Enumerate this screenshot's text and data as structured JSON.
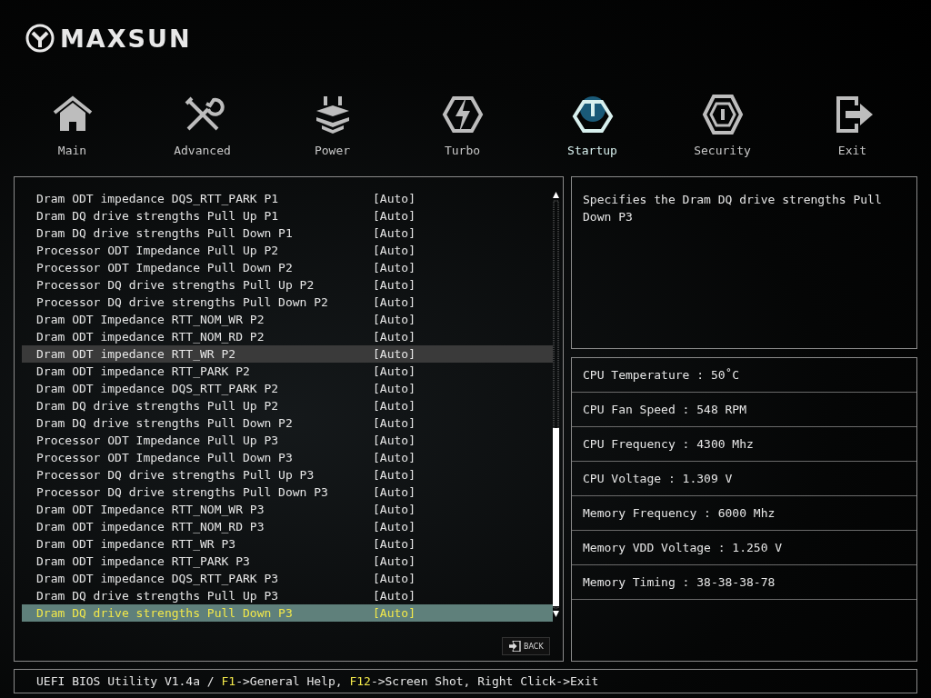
{
  "brand": {
    "name": "MAXSUN"
  },
  "tabs": [
    {
      "label": "Main",
      "selected": false
    },
    {
      "label": "Advanced",
      "selected": false
    },
    {
      "label": "Power",
      "selected": false
    },
    {
      "label": "Turbo",
      "selected": false
    },
    {
      "label": "Startup",
      "selected": true
    },
    {
      "label": "Security",
      "selected": false
    },
    {
      "label": "Exit",
      "selected": false
    }
  ],
  "settings": [
    {
      "name": "Dram ODT impedance DQS_RTT_PARK P1",
      "value": "[Auto]",
      "selected": false,
      "hovered": false
    },
    {
      "name": "Dram DQ drive strengths Pull Up P1",
      "value": "[Auto]",
      "selected": false,
      "hovered": false
    },
    {
      "name": "Dram DQ drive strengths Pull Down P1",
      "value": "[Auto]",
      "selected": false,
      "hovered": false
    },
    {
      "name": "Processor ODT Impedance Pull Up P2",
      "value": "[Auto]",
      "selected": false,
      "hovered": false
    },
    {
      "name": "Processor ODT Impedance Pull Down P2",
      "value": "[Auto]",
      "selected": false,
      "hovered": false
    },
    {
      "name": "Processor DQ drive strengths Pull Up P2",
      "value": "[Auto]",
      "selected": false,
      "hovered": false
    },
    {
      "name": "Processor DQ drive strengths Pull Down P2",
      "value": "[Auto]",
      "selected": false,
      "hovered": false
    },
    {
      "name": "Dram ODT Impedance RTT_NOM_WR P2",
      "value": "[Auto]",
      "selected": false,
      "hovered": false
    },
    {
      "name": "Dram ODT impedance RTT_NOM_RD P2",
      "value": "[Auto]",
      "selected": false,
      "hovered": false
    },
    {
      "name": "Dram ODT impedance RTT_WR P2",
      "value": "[Auto]",
      "selected": false,
      "hovered": true
    },
    {
      "name": "Dram ODT impedance RTT_PARK P2",
      "value": "[Auto]",
      "selected": false,
      "hovered": false
    },
    {
      "name": "Dram ODT impedance DQS_RTT_PARK P2",
      "value": "[Auto]",
      "selected": false,
      "hovered": false
    },
    {
      "name": "Dram DQ drive strengths Pull Up P2",
      "value": "[Auto]",
      "selected": false,
      "hovered": false
    },
    {
      "name": "Dram DQ drive strengths Pull Down P2",
      "value": "[Auto]",
      "selected": false,
      "hovered": false
    },
    {
      "name": "Processor ODT Impedance Pull Up P3",
      "value": "[Auto]",
      "selected": false,
      "hovered": false
    },
    {
      "name": "Processor ODT Impedance Pull Down P3",
      "value": "[Auto]",
      "selected": false,
      "hovered": false
    },
    {
      "name": "Processor DQ drive strengths Pull Up P3",
      "value": "[Auto]",
      "selected": false,
      "hovered": false
    },
    {
      "name": "Processor DQ drive strengths Pull Down P3",
      "value": "[Auto]",
      "selected": false,
      "hovered": false
    },
    {
      "name": "Dram ODT Impedance RTT_NOM_WR P3",
      "value": "[Auto]",
      "selected": false,
      "hovered": false
    },
    {
      "name": "Dram ODT impedance RTT_NOM_RD P3",
      "value": "[Auto]",
      "selected": false,
      "hovered": false
    },
    {
      "name": "Dram ODT impedance RTT_WR P3",
      "value": "[Auto]",
      "selected": false,
      "hovered": false
    },
    {
      "name": "Dram ODT impedance RTT_PARK P3",
      "value": "[Auto]",
      "selected": false,
      "hovered": false
    },
    {
      "name": "Dram ODT impedance DQS_RTT_PARK P3",
      "value": "[Auto]",
      "selected": false,
      "hovered": false
    },
    {
      "name": "Dram DQ drive strengths Pull Up P3",
      "value": "[Auto]",
      "selected": false,
      "hovered": false
    },
    {
      "name": "Dram DQ drive strengths Pull Down P3",
      "value": "[Auto]",
      "selected": true,
      "hovered": false
    }
  ],
  "back_button": {
    "label": "BACK"
  },
  "help": {
    "text": "Specifies the Dram DQ drive strengths Pull Down P3"
  },
  "monitor": [
    "CPU Temperature : 50˚C",
    "CPU Fan Speed : 548 RPM",
    "CPU Frequency : 4300 Mhz",
    "CPU Voltage : 1.309 V",
    "Memory Frequency : 6000 Mhz",
    "Memory VDD Voltage : 1.250 V",
    "Memory Timing : 38-38-38-78"
  ],
  "status_bar": [
    {
      "text": "UEFI BIOS Utility V1.4a / ",
      "highlight": false
    },
    {
      "text": "F1",
      "highlight": true
    },
    {
      "text": "->General Help, ",
      "highlight": false
    },
    {
      "text": "F12",
      "highlight": true
    },
    {
      "text": "->Screen Shot, Right Click->Exit",
      "highlight": false
    }
  ]
}
